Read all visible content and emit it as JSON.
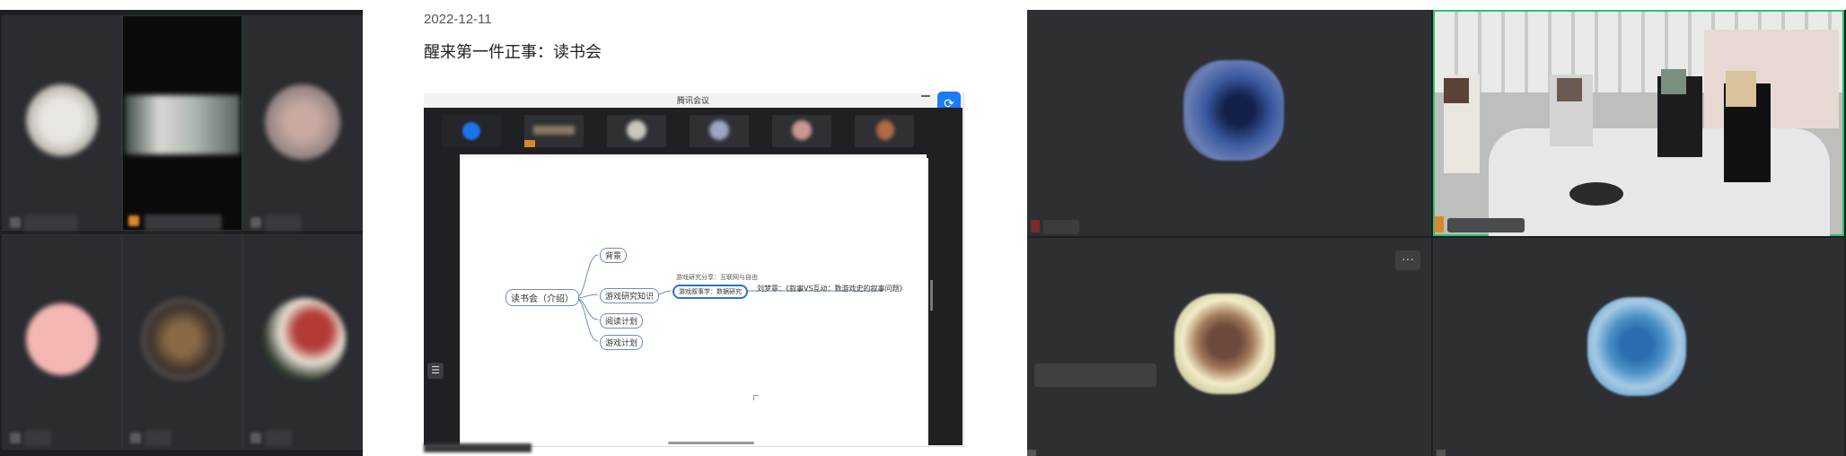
{
  "post": {
    "date": "2022-12-11",
    "title": "醒来第一件正事：读书会"
  },
  "meeting_app": {
    "window_title": "腾讯会议"
  },
  "mindmap": {
    "root": "读书会（介绍）",
    "branches": [
      "背景",
      "游戏研究知识",
      "阅读计划",
      "游戏计划"
    ],
    "sub_branch_note": "游戏研究分享：互联网与自由",
    "sub_branch_selected": "游戏叙事学：数据研究",
    "leaf_text": "刘梦霏：《叙事VS互动：数游戏史的叙事问题》"
  },
  "colors": {
    "meeting_bg": "#1e1f22",
    "tile_bg": "#2d2f33",
    "active_speaker_border": "#2fbf71",
    "mindmap_node_border": "#6b8dbf",
    "app_badge": "#1b7cf5"
  }
}
